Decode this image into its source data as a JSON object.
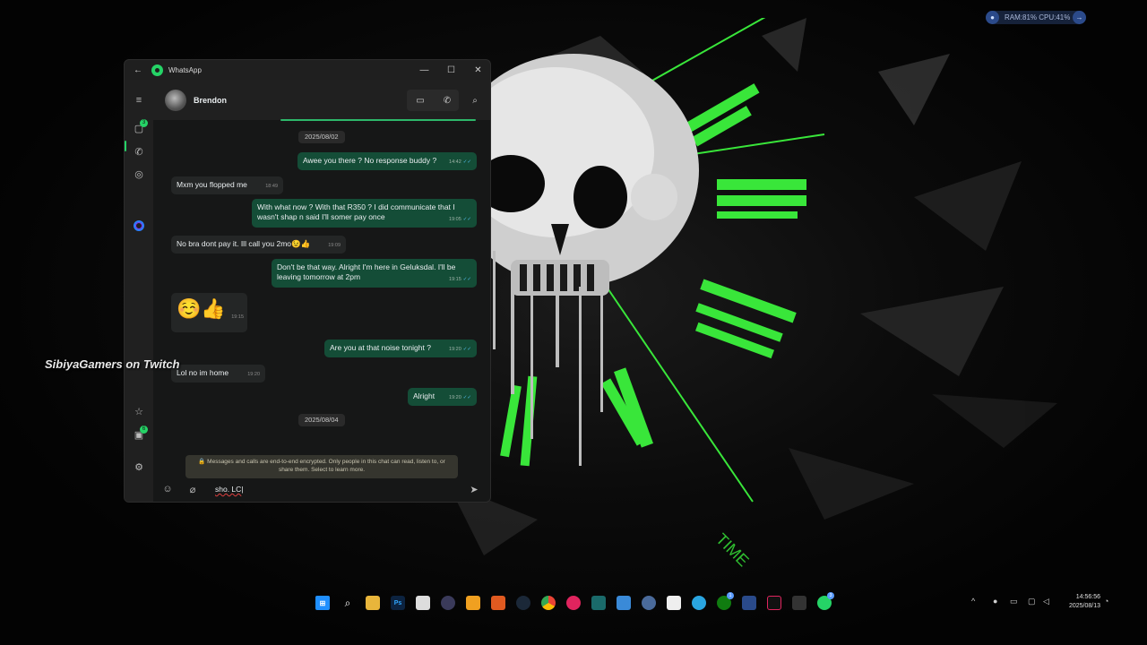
{
  "widget": {
    "ram_cpu": "RAM:81%  CPU:41%"
  },
  "overlay": {
    "text": "SibiyaGamers on Twitch"
  },
  "window": {
    "title": "WhatsApp",
    "minimize": "—",
    "maximize": "☐",
    "close": "✕"
  },
  "rail": {
    "chats_badge": "3",
    "archive_badge": "6"
  },
  "chat": {
    "contact_name": "Brendon",
    "date_chips": [
      "2025/08/02",
      "2025/08/04"
    ],
    "messages": [
      {
        "dir": "out",
        "text": "Awee you there ? No response buddy ?",
        "time": "14:42"
      },
      {
        "dir": "in",
        "text": "Mxm you flopped me",
        "time": "18:49"
      },
      {
        "dir": "out",
        "text": "With what now ? With that R350 ? I did communicate that I wasn't shap n said I'll somer pay once",
        "time": "19:05"
      },
      {
        "dir": "in",
        "text": "No bra dont pay it. Ill call you 2mo😉👍",
        "time": "19:09"
      },
      {
        "dir": "out",
        "text": "Don't be that way. Alright I'm here in Geluksdal. I'll be leaving tomorrow at 2pm",
        "time": "19:15"
      },
      {
        "dir": "in",
        "text": "☺️👍",
        "time": "19:15"
      },
      {
        "dir": "out",
        "text": "Are you at that noise tonight ?",
        "time": "19:20"
      },
      {
        "dir": "in",
        "text": "Lol no im home",
        "time": "19:20"
      },
      {
        "dir": "out",
        "text": "Alright",
        "time": "19:20"
      }
    ],
    "encryption_notice": "🔒 Messages and calls are end-to-end encrypted. Only people in this chat can read, listen to, or share them. Select to learn more.",
    "input_value": "sho. LC"
  },
  "taskbar": {
    "apps": [
      "windows-start",
      "search",
      "file-explorer",
      "photoshop",
      "store",
      "obs",
      "app-orange",
      "browser-brave",
      "steam",
      "chrome",
      "app-pink",
      "app-teal",
      "app-blue",
      "app-settings",
      "app-paint",
      "edge",
      "xbox",
      "app-news",
      "tiktok",
      "app-tv",
      "whatsapp"
    ],
    "xbox_badge": "1",
    "whatsapp_badge": "3",
    "time": "14:56:56",
    "date": "2025/08/13"
  },
  "colors": {
    "whatsapp_green": "#25d366",
    "outgoing_bubble": "#144d37",
    "incoming_bubble": "#242626",
    "skull_green": "#39e63a"
  }
}
